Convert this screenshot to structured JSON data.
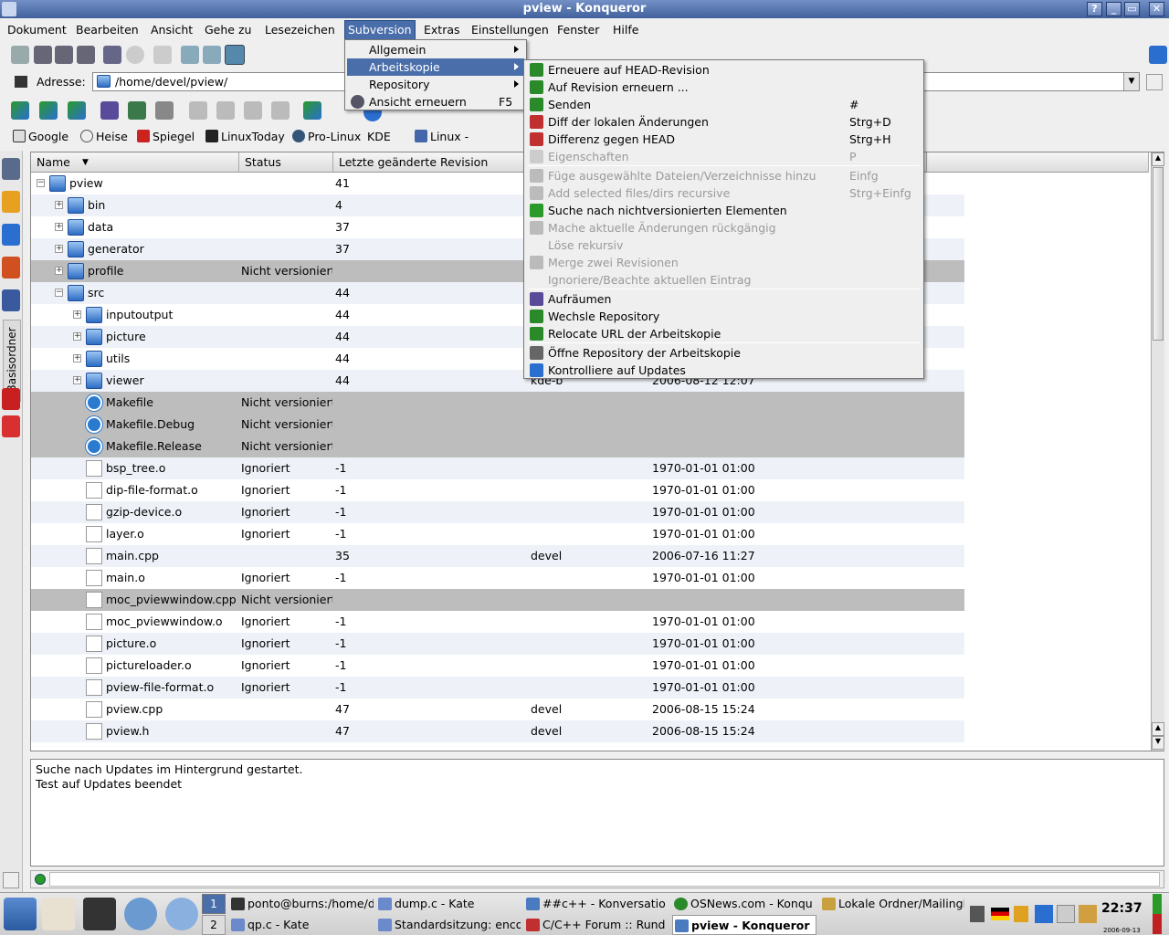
{
  "window": {
    "title": "pview - Konqueror",
    "buttons": [
      "?",
      "_",
      "▭",
      "✕"
    ]
  },
  "menubar": {
    "items": [
      "Dokument",
      "Bearbeiten",
      "Ansicht",
      "Gehe zu",
      "Lesezeichen",
      "Subversion",
      "Extras",
      "Einstellungen",
      "Fenster",
      "Hilfe"
    ]
  },
  "address": {
    "label": "Adresse:",
    "value": "/home/devel/pview/"
  },
  "bookmarks": [
    "Google",
    "Heise",
    "Spiegel",
    "LinuxToday",
    "Pro-Linux",
    "KDE",
    "Linux - Communit"
  ],
  "sidebar": {
    "label": "Basisordner"
  },
  "list": {
    "columns": [
      "Name",
      "Status",
      "Letzte geänderte Revision"
    ],
    "rows": [
      {
        "name": "pview",
        "status": "",
        "rev": "41",
        "author": "",
        "date": ""
      },
      {
        "name": "bin",
        "status": "",
        "rev": "4",
        "author": "",
        "date": ""
      },
      {
        "name": "data",
        "status": "",
        "rev": "37",
        "author": "",
        "date": ""
      },
      {
        "name": "generator",
        "status": "",
        "rev": "37",
        "author": "",
        "date": ""
      },
      {
        "name": "profile",
        "status": "Nicht versioniert",
        "rev": "",
        "author": "",
        "date": ""
      },
      {
        "name": "src",
        "status": "",
        "rev": "44",
        "author": "",
        "date": ""
      },
      {
        "name": "inputoutput",
        "status": "",
        "rev": "44",
        "author": "",
        "date": ""
      },
      {
        "name": "picture",
        "status": "",
        "rev": "44",
        "author": "",
        "date": ""
      },
      {
        "name": "utils",
        "status": "",
        "rev": "44",
        "author": "",
        "date": ""
      },
      {
        "name": "viewer",
        "status": "",
        "rev": "44",
        "author": "kde-b",
        "date": "2006-08-12 12:07"
      },
      {
        "name": "Makefile",
        "status": "Nicht versioniert",
        "rev": "",
        "author": "",
        "date": ""
      },
      {
        "name": "Makefile.Debug",
        "status": "Nicht versioniert",
        "rev": "",
        "author": "",
        "date": ""
      },
      {
        "name": "Makefile.Release",
        "status": "Nicht versioniert",
        "rev": "",
        "author": "",
        "date": ""
      },
      {
        "name": "bsp_tree.o",
        "status": "Ignoriert",
        "rev": "-1",
        "author": "",
        "date": "1970-01-01 01:00"
      },
      {
        "name": "dip-file-format.o",
        "status": "Ignoriert",
        "rev": "-1",
        "author": "",
        "date": "1970-01-01 01:00"
      },
      {
        "name": "gzip-device.o",
        "status": "Ignoriert",
        "rev": "-1",
        "author": "",
        "date": "1970-01-01 01:00"
      },
      {
        "name": "layer.o",
        "status": "Ignoriert",
        "rev": "-1",
        "author": "",
        "date": "1970-01-01 01:00"
      },
      {
        "name": "main.cpp",
        "status": "",
        "rev": "35",
        "author": "devel",
        "date": "2006-07-16 11:27"
      },
      {
        "name": "main.o",
        "status": "Ignoriert",
        "rev": "-1",
        "author": "",
        "date": "1970-01-01 01:00"
      },
      {
        "name": "moc_pviewwindow.cpp",
        "status": "Nicht versioniert",
        "rev": "",
        "author": "",
        "date": ""
      },
      {
        "name": "moc_pviewwindow.o",
        "status": "Ignoriert",
        "rev": "-1",
        "author": "",
        "date": "1970-01-01 01:00"
      },
      {
        "name": "picture.o",
        "status": "Ignoriert",
        "rev": "-1",
        "author": "",
        "date": "1970-01-01 01:00"
      },
      {
        "name": "pictureloader.o",
        "status": "Ignoriert",
        "rev": "-1",
        "author": "",
        "date": "1970-01-01 01:00"
      },
      {
        "name": "pview-file-format.o",
        "status": "Ignoriert",
        "rev": "-1",
        "author": "",
        "date": "1970-01-01 01:00"
      },
      {
        "name": "pview.cpp",
        "status": "",
        "rev": "47",
        "author": "devel",
        "date": "2006-08-15 15:24"
      },
      {
        "name": "pview.h",
        "status": "",
        "rev": "47",
        "author": "devel",
        "date": "2006-08-15 15:24"
      }
    ]
  },
  "messages": [
    "Suche nach Updates im Hintergrund gestartet.",
    "Test auf Updates beendet"
  ],
  "svnmenu": {
    "items": [
      {
        "label": "Allgemein",
        "shortcut": ""
      },
      {
        "label": "Arbeitskopie",
        "shortcut": ""
      },
      {
        "label": "Repository",
        "shortcut": ""
      },
      {
        "label": "Ansicht erneuern",
        "shortcut": "F5"
      }
    ]
  },
  "submenu": {
    "items": [
      {
        "label": "Erneuere auf HEAD-Revision",
        "shortcut": ""
      },
      {
        "label": "Auf Revision erneuern ...",
        "shortcut": ""
      },
      {
        "label": "Senden",
        "shortcut": "#"
      },
      {
        "label": "Diff der lokalen Änderungen",
        "shortcut": "Strg+D"
      },
      {
        "label": "Differenz gegen HEAD",
        "shortcut": "Strg+H"
      },
      {
        "label": "Eigenschaften",
        "shortcut": "P"
      },
      {
        "label": "Füge ausgewählte Dateien/Verzeichnisse hinzu",
        "shortcut": "Einfg"
      },
      {
        "label": "Add selected files/dirs recursive",
        "shortcut": "Strg+Einfg"
      },
      {
        "label": "Suche nach nichtversionierten Elementen",
        "shortcut": ""
      },
      {
        "label": "Mache aktuelle Änderungen rückgängig",
        "shortcut": ""
      },
      {
        "label": "Löse rekursiv",
        "shortcut": ""
      },
      {
        "label": "Merge zwei Revisionen",
        "shortcut": ""
      },
      {
        "label": "Ignoriere/Beachte aktuellen Eintrag",
        "shortcut": ""
      },
      {
        "label": "Aufräumen",
        "shortcut": ""
      },
      {
        "label": "Wechsle Repository",
        "shortcut": ""
      },
      {
        "label": "Relocate URL der Arbeitskopie",
        "shortcut": ""
      },
      {
        "label": "Öffne Repository der Arbeitskopie",
        "shortcut": ""
      },
      {
        "label": "Kontrolliere auf Updates",
        "shortcut": ""
      }
    ]
  },
  "taskbar": {
    "desktops": [
      "1",
      "2"
    ],
    "tasks": [
      "ponto@burns:/home/d",
      "dump.c - Kate",
      "##c++ - Konversatio",
      "OSNews.com - Konqu",
      "Lokale Ordner/Mailingl",
      "qp.c - Kate",
      "Standardsitzung: enco",
      "C/C++ Forum :: Rund",
      "pview - Konqueror"
    ],
    "clock": "22:37",
    "date": "2006-09-13"
  }
}
